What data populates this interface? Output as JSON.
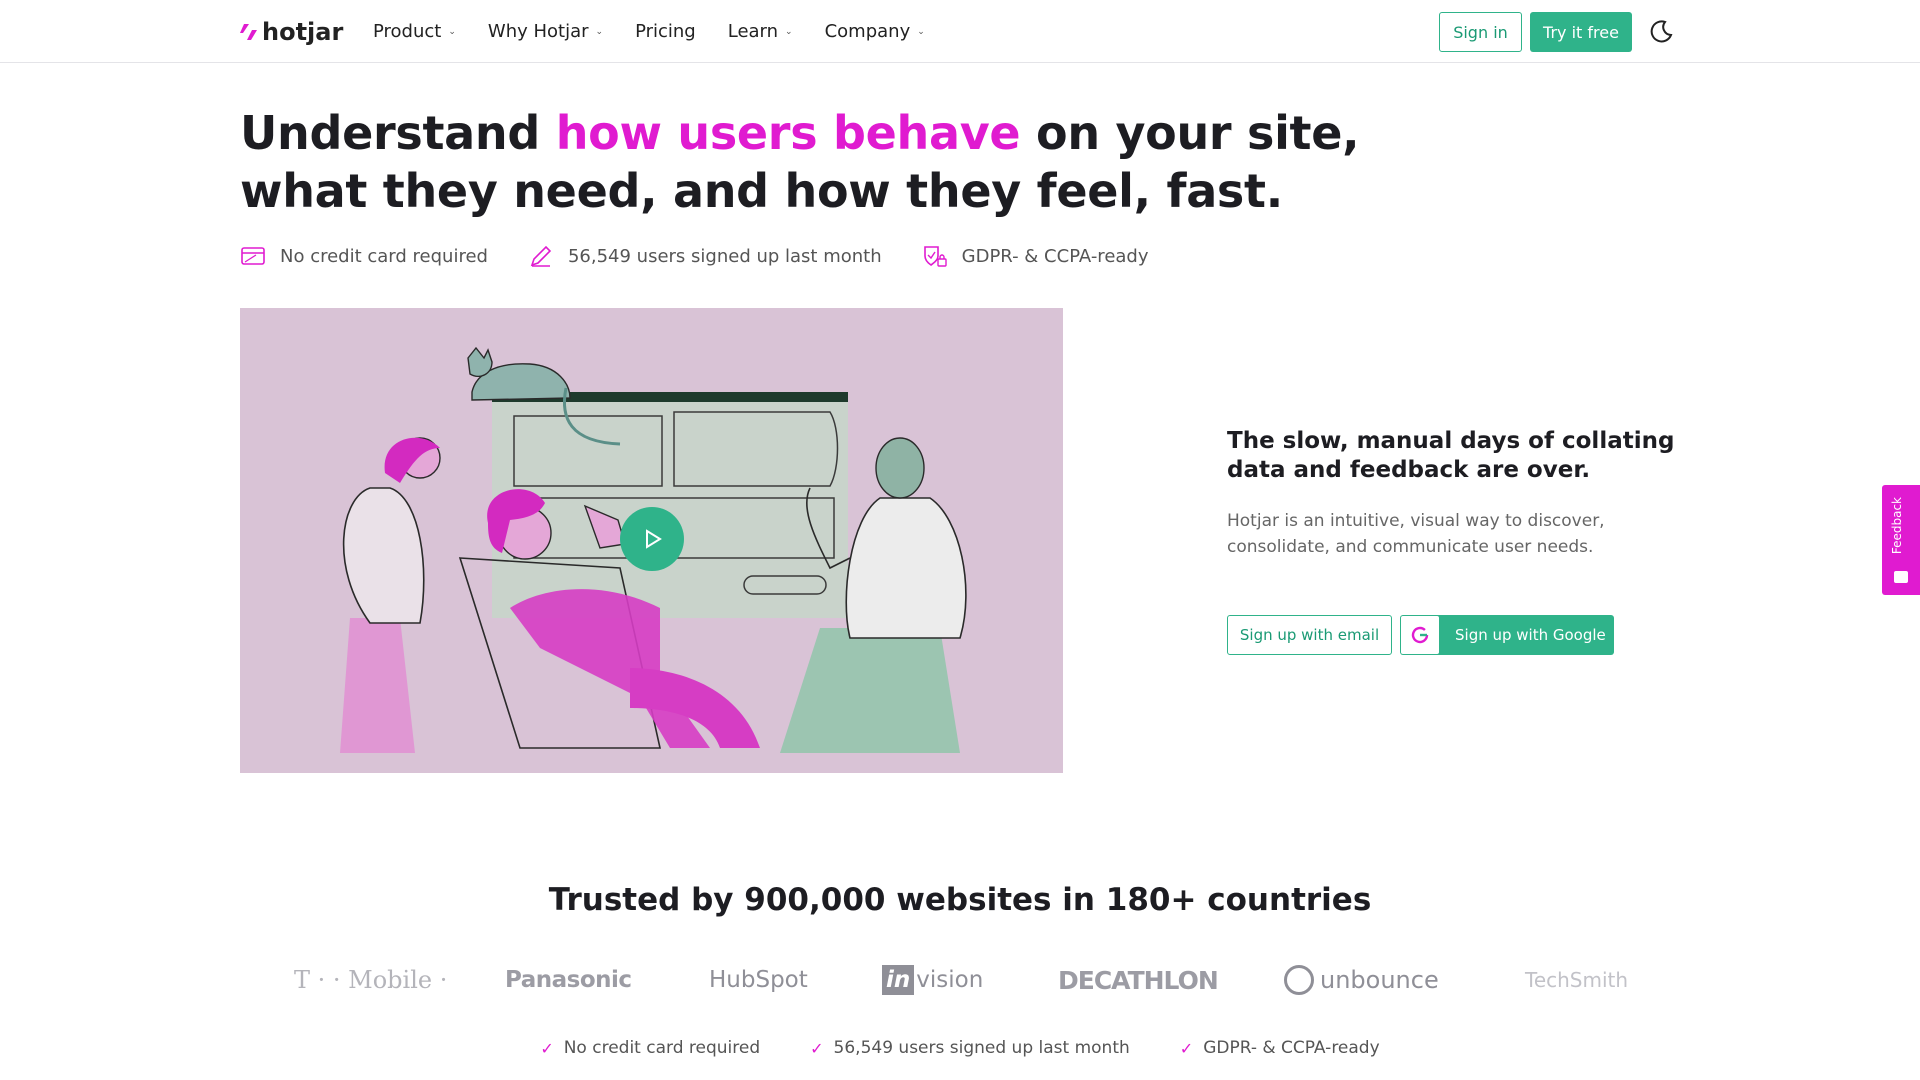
{
  "brand": {
    "name": "hotjar",
    "accent": "#e01bd0",
    "green": "#2fb38a"
  },
  "nav": {
    "items": [
      {
        "label": "Product",
        "has_dropdown": true
      },
      {
        "label": "Why Hotjar",
        "has_dropdown": true
      },
      {
        "label": "Pricing",
        "has_dropdown": false
      },
      {
        "label": "Learn",
        "has_dropdown": true
      },
      {
        "label": "Company",
        "has_dropdown": true
      }
    ],
    "sign_in": "Sign in",
    "try_free": "Try it free",
    "theme_icon": "moon-icon"
  },
  "hero": {
    "title_pre": "Understand ",
    "title_highlight": "how users behave",
    "title_post": " on your site, what they need, and how they feel, fast.",
    "features": [
      {
        "icon": "credit-card-icon",
        "text": "No credit card required"
      },
      {
        "icon": "pencil-icon",
        "text": "56,549 users signed up last month"
      },
      {
        "icon": "shield-lock-icon",
        "text": "GDPR- & CCPA-ready"
      }
    ]
  },
  "side": {
    "heading": "The slow, manual days of collating data and feedback are over.",
    "body": "Hotjar is an intuitive, visual way to discover, consolidate, and communicate user needs.",
    "signup_email": "Sign up with email",
    "signup_google": "Sign up with Google"
  },
  "feedback_tab": "Feedback",
  "trusted": {
    "heading": "Trusted by 900,000 websites in 180+ countries",
    "logos": [
      "T · · Mobile ·",
      "Panasonic",
      "HubSpot",
      "invision",
      "DECATHLON",
      "unbounce",
      "TechSmith"
    ]
  },
  "bottom_checks": [
    "No credit card required",
    "56,549 users signed up last month",
    "GDPR- & CCPA-ready"
  ]
}
